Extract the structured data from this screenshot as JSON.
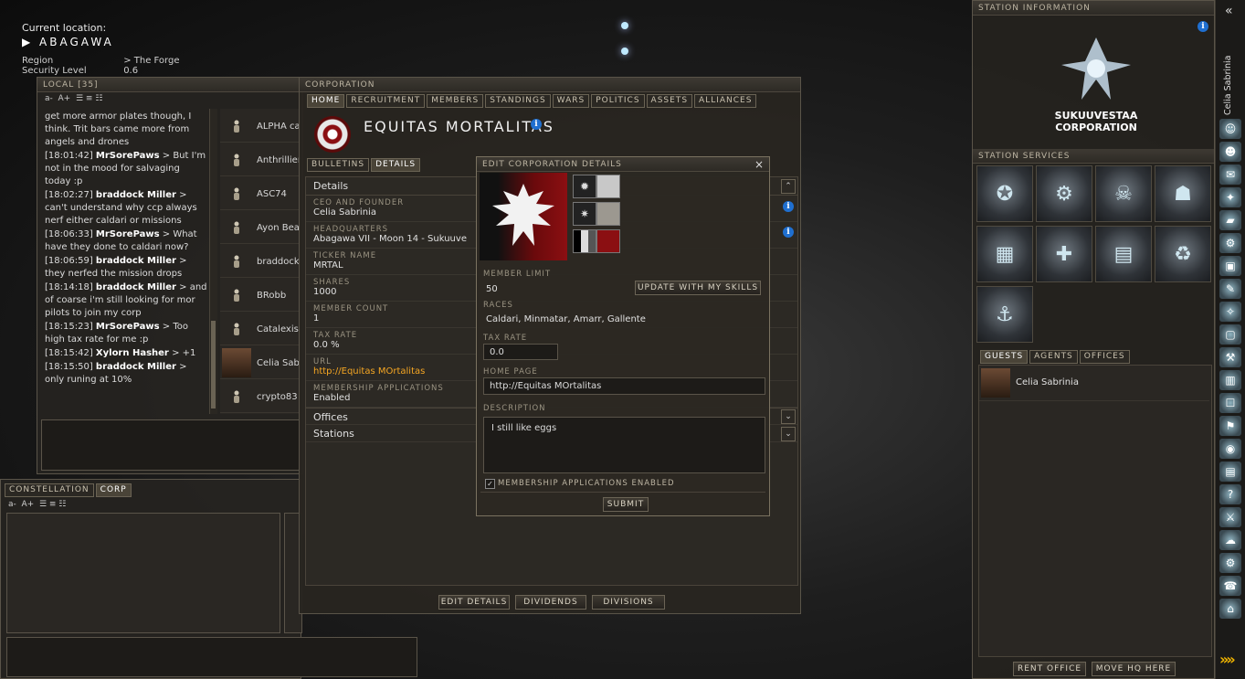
{
  "location": {
    "label": "Current location:",
    "name": "ABAGAWA",
    "region_label": "Region",
    "region_value": "> The Forge",
    "security_label": "Security Level",
    "security_value": "0.6"
  },
  "local": {
    "title": "LOCAL [35]",
    "font_minus": "a-",
    "font_plus": "A+",
    "messages": [
      {
        "time": "",
        "name": "",
        "text": "get more armor plates though, I think. Trit bars came more from angels and drones"
      },
      {
        "time": "[18:01:42]",
        "name": "MrSorePaws",
        "text": "> But I'm not in the mood for salvaging today :p"
      },
      {
        "time": "[18:02:27]",
        "name": "braddock Miller",
        "text": "> can't understand why ccp always nerf either caldari or missions"
      },
      {
        "time": "[18:06:33]",
        "name": "MrSorePaws",
        "text": "> What have they done to caldari now?"
      },
      {
        "time": "[18:06:59]",
        "name": "braddock Miller",
        "text": "> they nerfed the mission drops"
      },
      {
        "time": "[18:14:18]",
        "name": "braddock Miller",
        "text": "> and of coarse i'm still looking for mor pilots to join my corp"
      },
      {
        "time": "[18:15:23]",
        "name": "MrSorePaws",
        "text": "> Too high tax rate for me :p"
      },
      {
        "time": "[18:15:42]",
        "name": "Xylorn Hasher",
        "text": "> +1"
      },
      {
        "time": "[18:15:50]",
        "name": "braddock Miller",
        "text": "> only runing at 10%"
      }
    ],
    "members": [
      "ALPHA ca",
      "Anthrillien",
      "ASC74",
      "Ayon Bea",
      "braddock",
      "BRobb",
      "Catalexis",
      "Celia Sab",
      "crypto83"
    ]
  },
  "constellation": {
    "tabs": [
      "CONSTELLATION",
      "CORP"
    ],
    "font_minus": "a-",
    "font_plus": "A+"
  },
  "corp_window": {
    "title": "CORPORATION",
    "tabs": [
      "HOME",
      "RECRUITMENT",
      "MEMBERS",
      "STANDINGS",
      "WARS",
      "POLITICS",
      "ASSETS",
      "ALLIANCES"
    ],
    "corp_name": "EQUITAS MORTALITAS",
    "subtabs": [
      "BULLETINS",
      "DETAILS"
    ],
    "section_details": "Details",
    "fields": [
      {
        "label": "CEO AND FOUNDER",
        "value": "Celia Sabrinia"
      },
      {
        "label": "HEADQUARTERS",
        "value": "Abagawa VII - Moon 14 - Sukuuve"
      },
      {
        "label": "TICKER NAME",
        "value": "MRTAL"
      },
      {
        "label": "SHARES",
        "value": "1000"
      },
      {
        "label": "MEMBER COUNT",
        "value": "1"
      },
      {
        "label": "TAX RATE",
        "value": "0.0 %"
      },
      {
        "label": "URL",
        "value": "http://Equitas MOrtalitas"
      },
      {
        "label": "MEMBERSHIP APPLICATIONS",
        "value": "Enabled"
      }
    ],
    "section_offices": "Offices",
    "section_stations": "Stations",
    "bottom_buttons": [
      "EDIT DETAILS",
      "DIVIDENDS",
      "DIVISIONS"
    ]
  },
  "edit_dialog": {
    "title": "EDIT CORPORATION DETAILS",
    "close": "×",
    "member_limit_label": "MEMBER LIMIT",
    "member_limit_value": "50",
    "update_button": "UPDATE WITH MY SKILLS",
    "races_label": "RACES",
    "races_value": "Caldari, Minmatar, Amarr, Gallente",
    "tax_rate_label": "TAX RATE",
    "tax_rate_value": "0.0",
    "home_page_label": "HOME PAGE",
    "home_page_value": "http://Equitas MOrtalitas",
    "description_label": "DESCRIPTION",
    "description_value": "I still like eggs",
    "membership_checkbox": "MEMBERSHIP APPLICATIONS ENABLED",
    "submit": "SUBMIT",
    "logo_colors": {
      "primary": "#8b0f12",
      "secondary": "#c8c8c8",
      "black": "#111111"
    }
  },
  "station": {
    "info_title": "STATION INFORMATION",
    "corp_logo_line1": "SUKUUVESTAA",
    "corp_logo_line2": "CORPORATION",
    "services_title": "STATION SERVICES",
    "services": [
      "officer-icon",
      "ship-fitting-icon",
      "bounty-icon",
      "clone-bay-icon",
      "factory-icon",
      "repair-icon",
      "market-icon",
      "reprocessing-icon",
      "insurance-icon"
    ],
    "guest_tabs": [
      "GUESTS",
      "AGENTS",
      "OFFICES"
    ],
    "guests": [
      "Celia Sabrinia"
    ],
    "rent_office": "RENT OFFICE",
    "move_hq": "MOVE HQ HERE"
  },
  "sidebar": {
    "username": "Celia Sabrinia",
    "collapse": "«",
    "expand": "»»"
  }
}
